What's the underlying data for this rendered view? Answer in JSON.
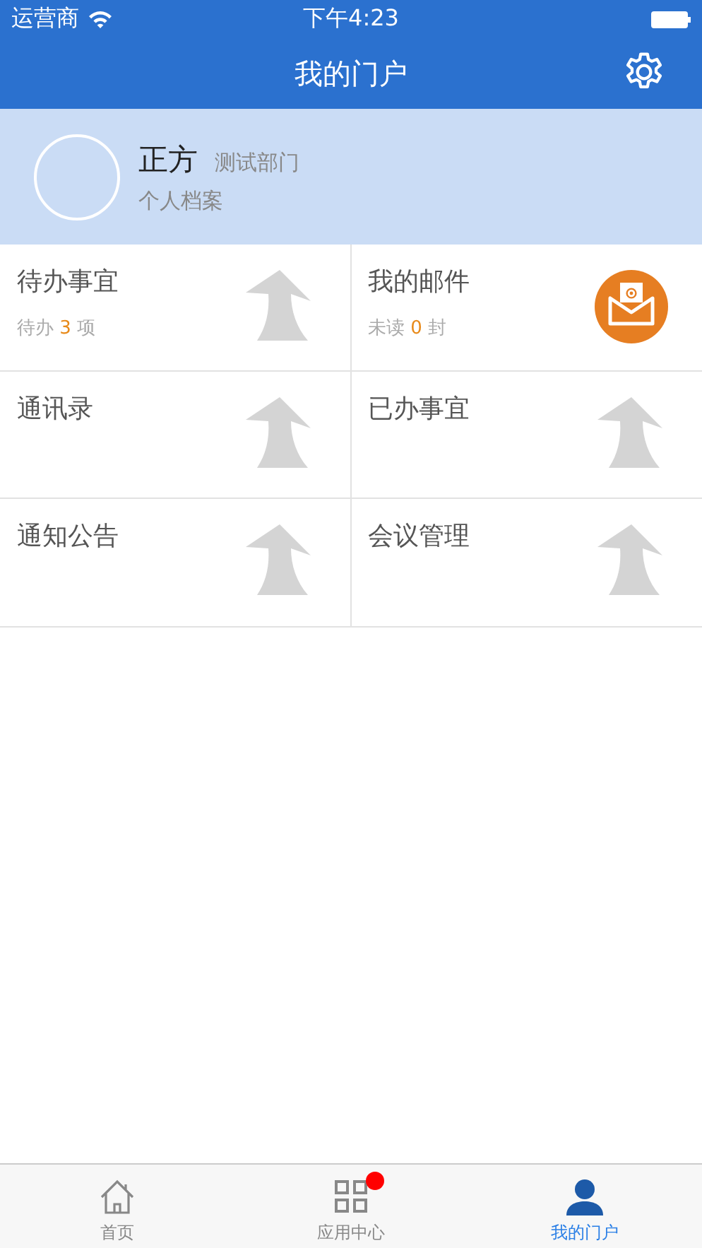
{
  "status_bar": {
    "carrier": "运营商",
    "time": "下午4:23"
  },
  "nav": {
    "title": "我的门户"
  },
  "profile": {
    "name": "正方",
    "department": "测试部门",
    "link": "个人档案"
  },
  "tiles": [
    {
      "title": "待办事宜",
      "kind": "placeholder",
      "sub_prefix": "待办",
      "count": "3",
      "sub_suffix": "项"
    },
    {
      "title": "我的邮件",
      "kind": "mail",
      "sub_prefix": "未读",
      "count": "0",
      "sub_suffix": "封"
    },
    {
      "title": "通讯录",
      "kind": "placeholder"
    },
    {
      "title": "已办事宜",
      "kind": "placeholder"
    },
    {
      "title": "通知公告",
      "kind": "placeholder"
    },
    {
      "title": "会议管理",
      "kind": "placeholder"
    }
  ],
  "tab_bar": [
    {
      "label": "首页",
      "kind": "home",
      "selected": false,
      "badge": false
    },
    {
      "label": "应用中心",
      "kind": "apps",
      "selected": false,
      "badge": true
    },
    {
      "label": "我的门户",
      "kind": "person",
      "selected": true,
      "badge": false
    }
  ]
}
